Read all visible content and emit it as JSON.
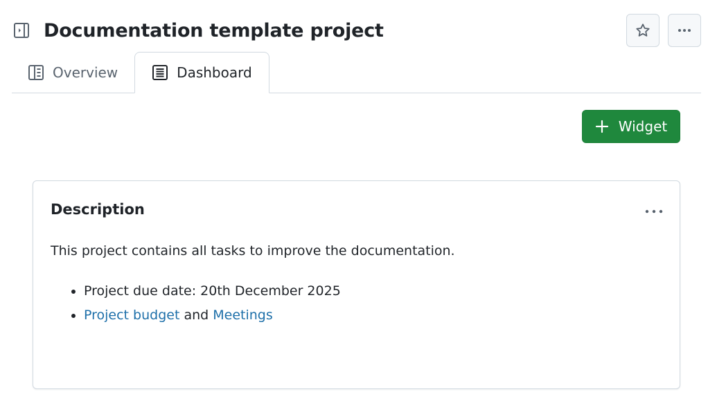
{
  "header": {
    "title": "Documentation template project",
    "icons": {
      "sidebar_toggle": "sidebar-expand-icon",
      "star": "star-icon",
      "more": "kebab-horizontal-icon"
    }
  },
  "tabs": [
    {
      "label": "Overview",
      "icon": "book-icon",
      "active": false
    },
    {
      "label": "Dashboard",
      "icon": "note-icon",
      "active": true
    }
  ],
  "actions": {
    "add_widget_label": "Widget",
    "add_widget_icon": "plus-icon"
  },
  "card": {
    "title": "Description",
    "description": "This project contains all tasks to improve the documentation.",
    "list": {
      "item1": "Project due date: 20th December 2025",
      "item2": {
        "link1": "Project budget",
        "connector": " and ",
        "link2": "Meetings"
      }
    },
    "menu_icon": "kebab-horizontal-icon"
  },
  "colors": {
    "primary_button": "#1f883d",
    "link": "#1d6fa9",
    "border": "#d1d9e0",
    "text": "#1f2328",
    "muted": "#59636e"
  }
}
